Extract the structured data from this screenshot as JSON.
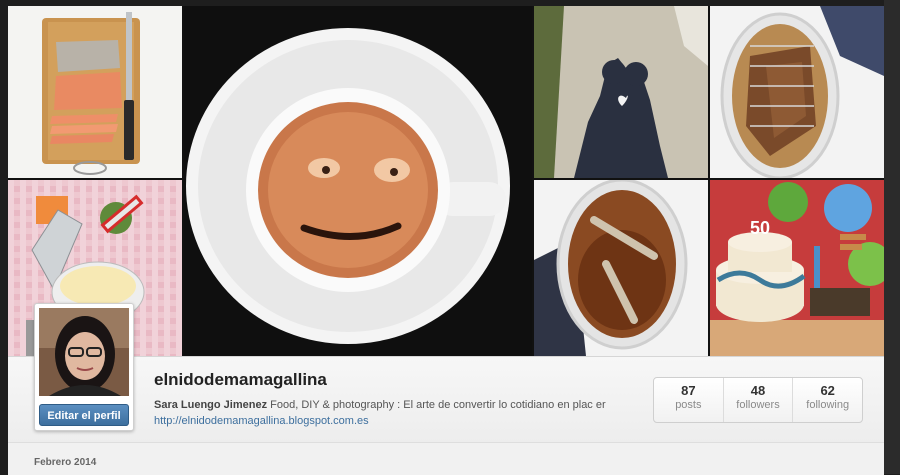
{
  "profile": {
    "username": "elnidodemamagallina",
    "full_name": "Sara Luengo Jimenez",
    "bio": "Food, DIY & photography : El arte de convertir lo cotidiano en plac er",
    "website": "http://elnidodemamagallina.blogspot.com.es",
    "edit_button": "Editar el perfil"
  },
  "stats": [
    {
      "value": "87",
      "label": "posts"
    },
    {
      "value": "48",
      "label": "followers"
    },
    {
      "value": "62",
      "label": "following"
    }
  ],
  "feed": {
    "month_header": "Febrero 2014"
  },
  "photos": [
    {
      "subject": "salmon-on-cutting-board"
    },
    {
      "subject": "grater-and-cheese"
    },
    {
      "subject": "smiley-coffee-cup"
    },
    {
      "subject": "couple-shadow-kiss"
    },
    {
      "subject": "roast-lamb-in-dish"
    },
    {
      "subject": "bones-in-broth"
    },
    {
      "subject": "birthday-cake-50"
    }
  ],
  "colors": {
    "link": "#3d6f9e",
    "button": "#4a7fb0"
  }
}
